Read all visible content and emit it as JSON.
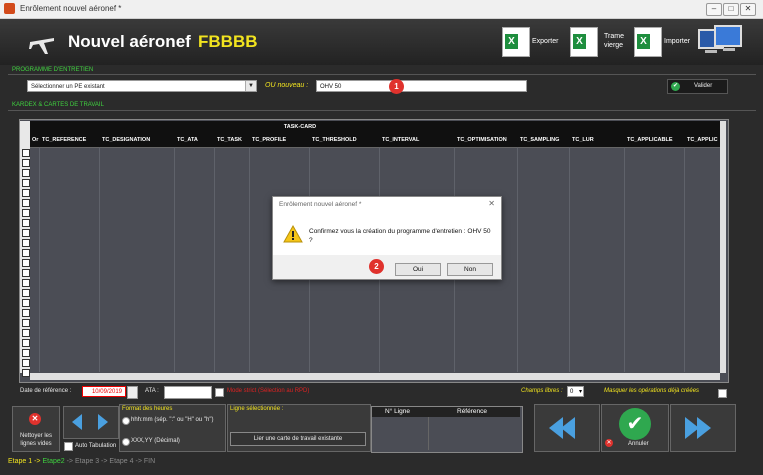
{
  "window": {
    "title": "Enrôlement nouvel aéronef *"
  },
  "header": {
    "title": "Nouvel aéronef",
    "registration": "FBBBB",
    "exporter": "Exporter",
    "trame_line1": "Trame",
    "trame_line2": "vierge",
    "importer": "Importer"
  },
  "programme": {
    "section_label": "PROGRAMME D'ENTRETIEN",
    "select_value": "Sélectionner un PE existant",
    "ou_label": "OU nouveau :",
    "new_value": "OHV 50",
    "valider": "Valider"
  },
  "kardex": {
    "section_label": "KARDEX & CARTES DE TRAVAIL",
    "group_header": "TASK-CARD",
    "columns": [
      "Or",
      "TC_REFERENCE",
      "TC_DESIGNATION",
      "TC_ATA",
      "TC_TASK",
      "TC_PROFILE",
      "TC_THRESHOLD",
      "TC_INTERVAL",
      "TC_OPTIMISATION",
      "TC_SAMPLING",
      "TC_LUR",
      "TC_APPLICABLE",
      "TC_APPLIC"
    ]
  },
  "filters": {
    "date_label": "Date de référence :",
    "date_value": "10/09/2019",
    "ata_label": "ATA :",
    "strict_label": "Mode strict (Sélection au RPD)",
    "champs_label": "Champs libres :",
    "champs_value": "0",
    "masquer_label": "Masquer les opérations déjà créées"
  },
  "bottom": {
    "nettoyer": "Nettoyer les lignes vides",
    "auto_tab": "Auto Tabulation",
    "format_title": "Format des heures",
    "format_opt1": "hhh:mm (sép. \":\" ou \"H\" ou \"h\")",
    "format_opt2": "XXX,YY (Décimal)",
    "ligne_title": "Ligne sélectionnée :",
    "lier_button": "Lier une carte de travail existante",
    "col_nligne": "N° Ligne",
    "col_reference": "Référence",
    "annuler": "Annuler",
    "steps": [
      "Etape 1",
      "Etape2",
      "Etape 3",
      "Etape 4",
      "FIN"
    ]
  },
  "dialog": {
    "title": "Enrôlement nouvel aéronef *",
    "message": "Confirmez vous la création du programme d'entretien : OHV 50 ?",
    "oui": "Oui",
    "non": "Non"
  },
  "badges": {
    "one": "1",
    "two": "2"
  },
  "colors": {
    "accent_green": "#3fd13f",
    "accent_yellow": "#f2e41f",
    "badge_red": "#e0322d",
    "date_red": "#d22"
  }
}
